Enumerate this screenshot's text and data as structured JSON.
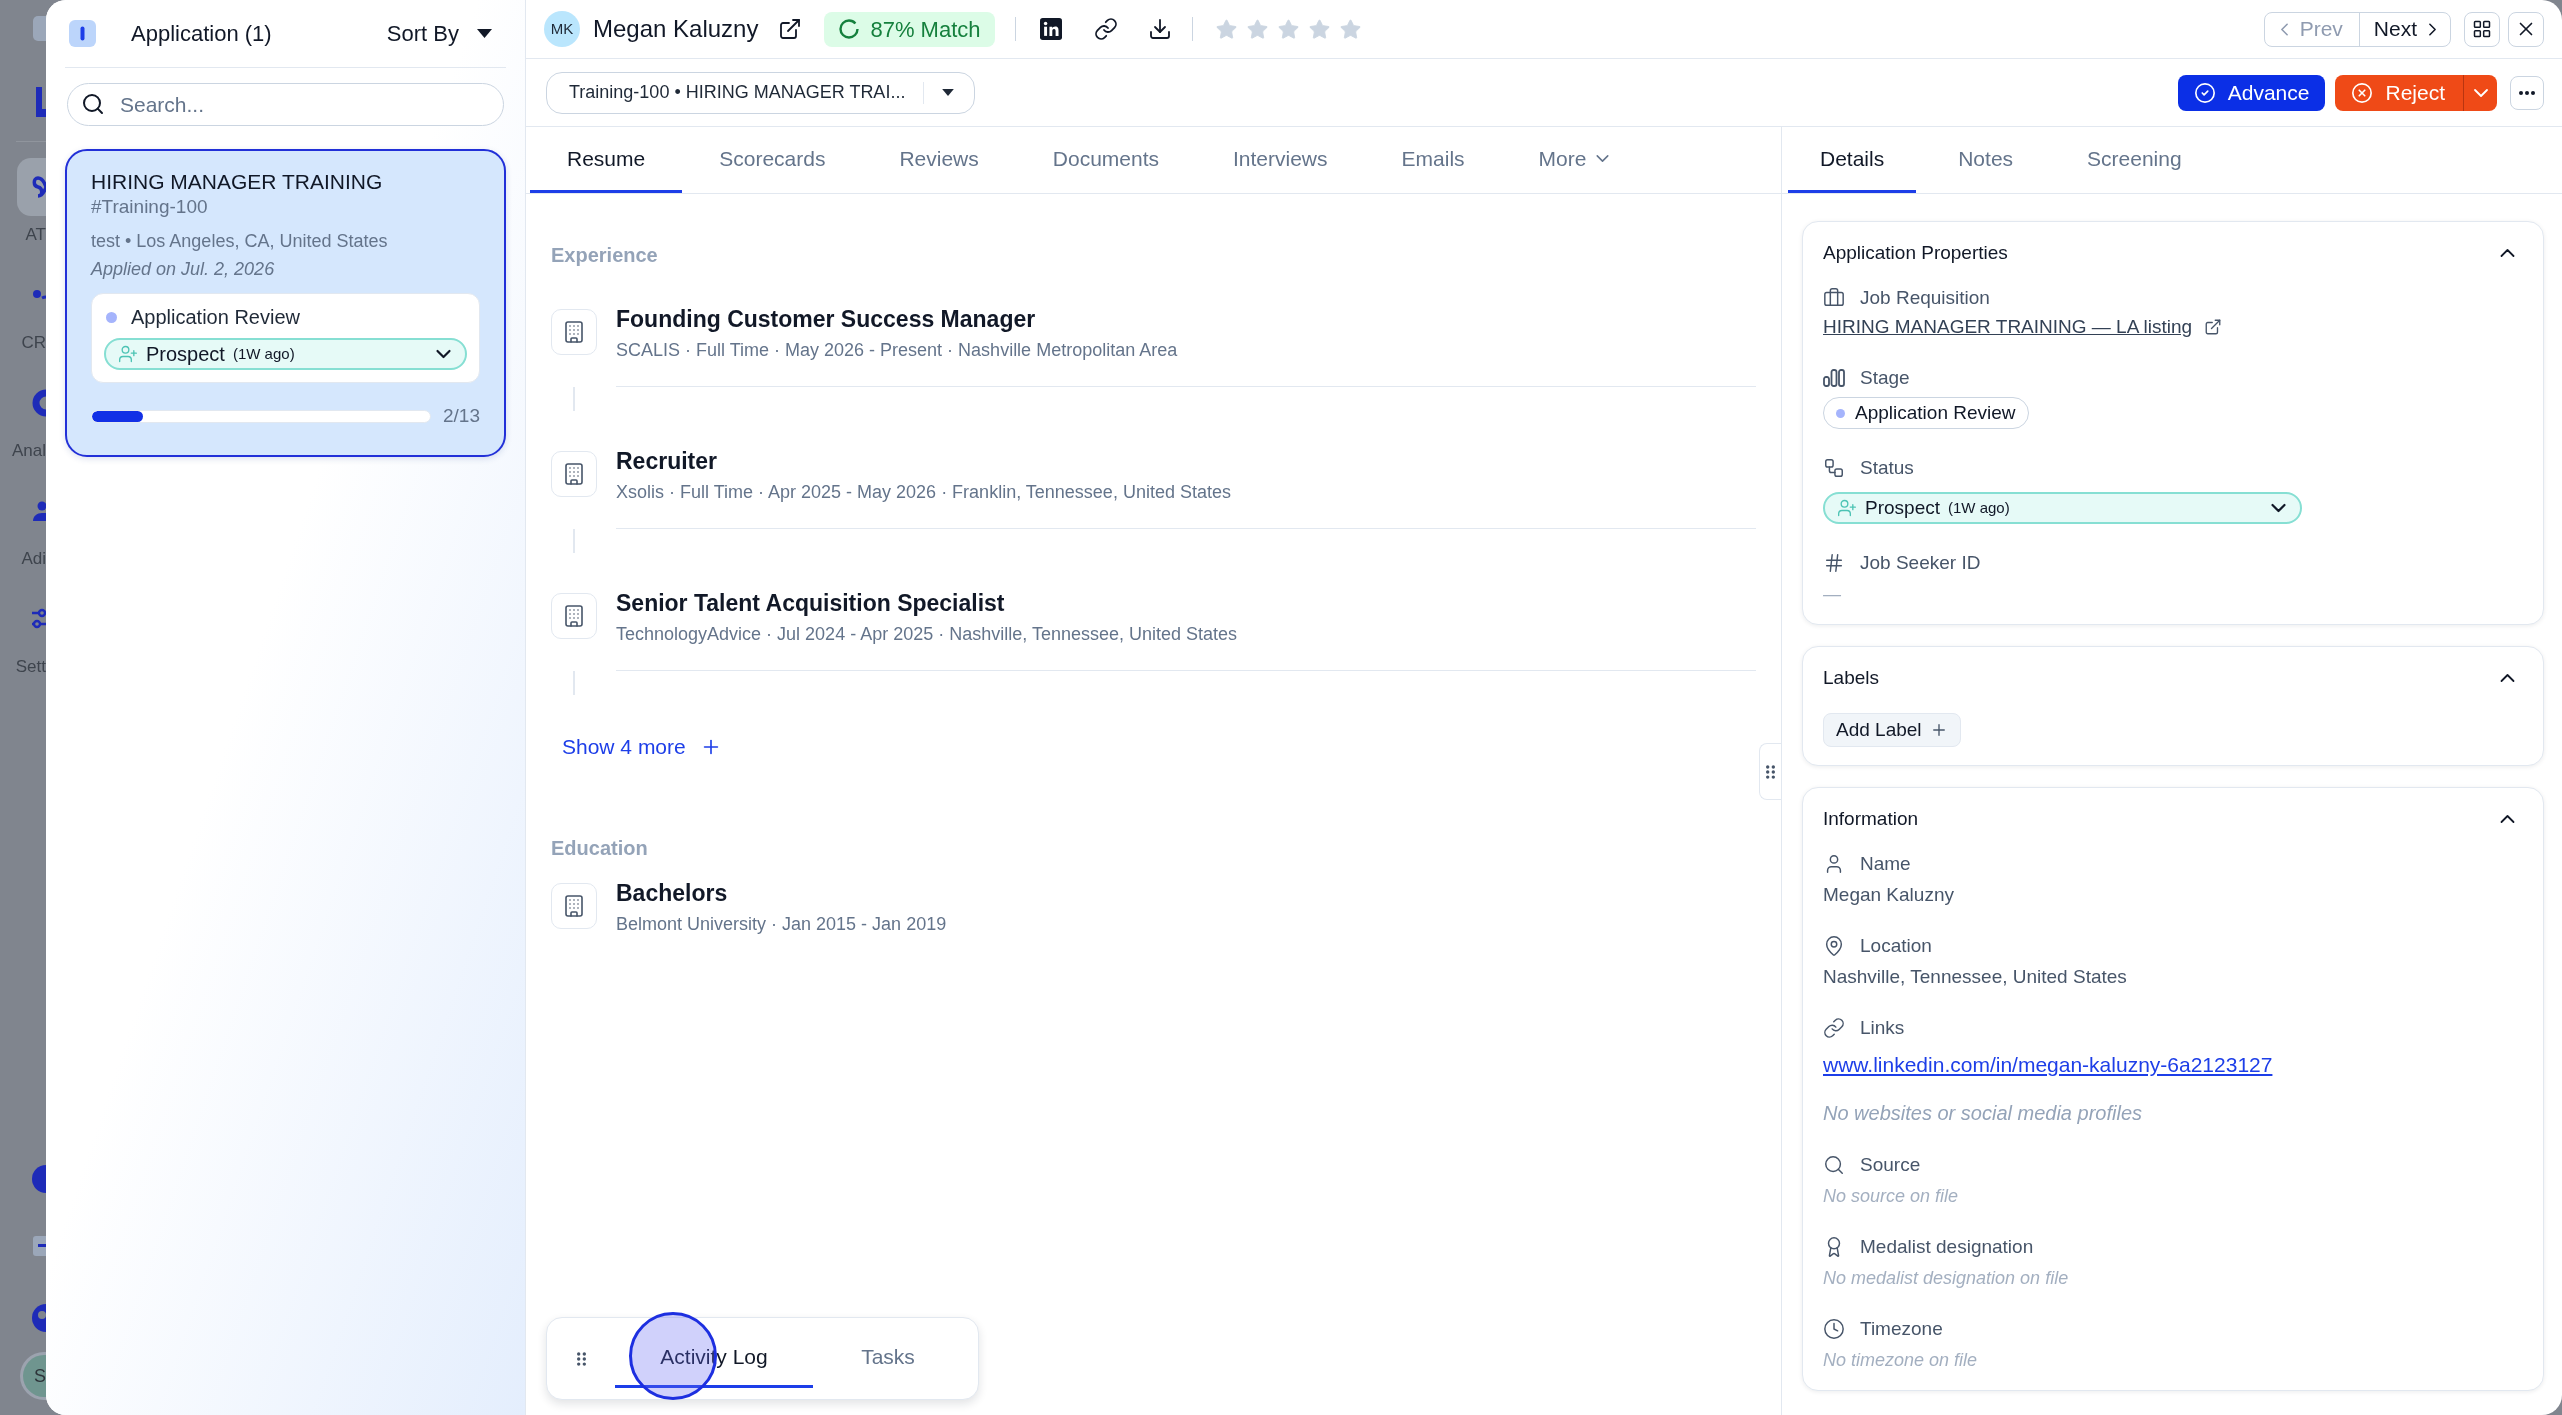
{
  "backdrop_nav": {
    "items": [
      {
        "label": "AT",
        "selected": true
      },
      {
        "label": "CR",
        "selected": false
      },
      {
        "label": "Anal",
        "selected": false
      },
      {
        "label": "Adi",
        "selected": false
      },
      {
        "label": "Sett",
        "selected": false
      }
    ],
    "avatar": "S"
  },
  "applications_panel": {
    "title": "Application (1)",
    "sort_label": "Sort By",
    "search": {
      "placeholder": "Search..."
    },
    "cards": [
      {
        "title": "HIRING MANAGER TRAINING",
        "code": "#Training-100",
        "meta": "test • Los Angeles, CA, United States",
        "applied": "Applied on Jul. 2, 2026",
        "selected": true,
        "stage": {
          "label": "Application Review",
          "color": "#a5b4fc"
        },
        "status": {
          "label": "Prospect",
          "age": "(1W ago)"
        },
        "progress": {
          "level": 0.15,
          "reading": "2/13"
        }
      }
    ]
  },
  "candidate": {
    "initials": "MK",
    "name": "Megan Kaluzny",
    "match": "87% Match",
    "stars": 0
  },
  "nav": {
    "prev": {
      "label": "Prev",
      "disabled": true
    },
    "next": {
      "label": "Next",
      "disabled": false
    }
  },
  "job_select": {
    "value": "Training-100 • HIRING MANAGER TRAI..."
  },
  "actions": [
    {
      "kind": "advance",
      "label": "Advance"
    },
    {
      "kind": "reject",
      "label": "Reject"
    }
  ],
  "main_tabs": [
    {
      "label": "Resume",
      "selected": true,
      "kind": "tab"
    },
    {
      "label": "Scorecards",
      "selected": false,
      "kind": "tab"
    },
    {
      "label": "Reviews",
      "selected": false,
      "kind": "tab"
    },
    {
      "label": "Documents",
      "selected": false,
      "kind": "tab"
    },
    {
      "label": "Interviews",
      "selected": false,
      "kind": "tab"
    },
    {
      "label": "Emails",
      "selected": false,
      "kind": "tab"
    },
    {
      "label": "More",
      "selected": false,
      "kind": "menu"
    }
  ],
  "resume": {
    "sections": [
      {
        "title": "Experience",
        "kind": "timeline",
        "entries": [
          {
            "title": "Founding Customer Success Manager",
            "details": "SCALIS · Full Time · May 2026 - Present · Nashville Metropolitan Area"
          },
          {
            "title": "Recruiter",
            "details": "Xsolis · Full Time · Apr 2025 - May 2026 · Franklin, Tennessee, United States"
          },
          {
            "title": "Senior Talent Acquisition Specialist",
            "details": "TechnologyAdvice · Jul 2024 - Apr 2025 · Nashville, Tennessee, United States"
          }
        ],
        "more": "Show 4 more"
      },
      {
        "title": "Education",
        "kind": "list",
        "entries": [
          {
            "title": "Bachelors",
            "details": "Belmont University · Jan 2015 - Jan 2019"
          }
        ]
      }
    ]
  },
  "side_tabs": [
    {
      "label": "Details",
      "selected": true
    },
    {
      "label": "Notes",
      "selected": false
    },
    {
      "label": "Screening",
      "selected": false
    }
  ],
  "details_cards": [
    {
      "kind": "fields",
      "title": "Application Properties",
      "expanded": true,
      "fields": [
        {
          "kind": "link",
          "label": "Job Requisition",
          "value": "HIRING MANAGER TRAINING — LA listing"
        },
        {
          "kind": "stage",
          "label": "Stage",
          "value": "Application Review",
          "color": "#a5b4fc"
        },
        {
          "kind": "status",
          "label": "Status",
          "value": "Prospect",
          "age": "(1W ago)"
        },
        {
          "kind": "empty",
          "label": "Job Seeker ID",
          "value": "—"
        }
      ]
    },
    {
      "kind": "labels",
      "title": "Labels",
      "expanded": true,
      "add_label": "Add Label"
    },
    {
      "kind": "fields",
      "title": "Information",
      "expanded": true,
      "fields": [
        {
          "kind": "text",
          "label": "Name",
          "value": "Megan Kaluzny"
        },
        {
          "kind": "text",
          "label": "Location",
          "value": "Nashville, Tennessee, United States"
        },
        {
          "kind": "links",
          "label": "Links",
          "value": "www.linkedin.com/in/megan-kaluzny-6a2123127",
          "note": "No websites or social media profiles"
        },
        {
          "kind": "empty",
          "label": "Source",
          "value": "No source on file"
        },
        {
          "kind": "empty",
          "label": "Medalist designation",
          "value": "No medalist designation on file"
        },
        {
          "kind": "empty",
          "label": "Timezone",
          "value": "No timezone on file"
        }
      ]
    }
  ],
  "bottom_tabs": [
    {
      "label": "Activity Log",
      "selected": true
    },
    {
      "label": "Tasks",
      "selected": false
    }
  ]
}
